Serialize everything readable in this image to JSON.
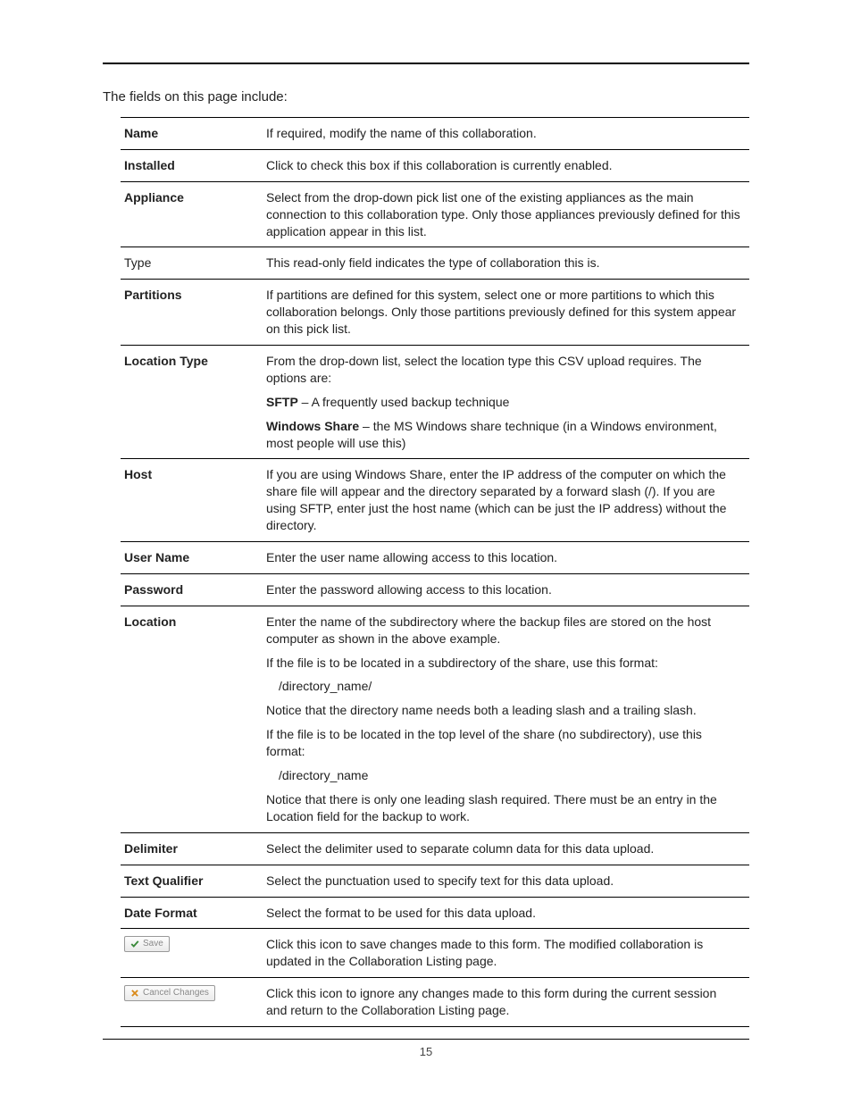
{
  "intro": "The fields on this page include:",
  "rows": {
    "name": {
      "label": "Name",
      "desc": "If required, modify the name of this collaboration."
    },
    "installed": {
      "label": "Installed",
      "desc": "Click to check this box if this collaboration is currently enabled."
    },
    "appliance": {
      "label": "Appliance",
      "desc": "Select from the drop-down pick list one of the existing appliances as the main connection to this collaboration type. Only those appliances previously defined for this application appear in this list."
    },
    "type": {
      "label": "Type",
      "desc": "This read-only field indicates the type of collaboration this is."
    },
    "partitions": {
      "label": "Partitions",
      "desc": "If partitions are defined for this system, select one or more partitions to which this collaboration belongs. Only those partitions previously defined for this system appear on this pick list."
    },
    "location_type": {
      "label": "Location Type",
      "p1": "From the drop-down list, select the location type this CSV upload requires. The options are:",
      "sftp_bold": "SFTP",
      "sftp_rest": " – A frequently used backup technique",
      "ws_bold": "Windows Share",
      "ws_rest": " – the MS Windows share technique (in a Windows environment, most people will use this)"
    },
    "host": {
      "label": "Host",
      "desc": "If you are using Windows Share, enter the IP address of the computer on which the share file will appear and the directory separated by a forward slash (/). If you are using SFTP, enter just the host name (which can be just the IP address) without the directory."
    },
    "username": {
      "label": "User Name",
      "desc": "Enter the user name allowing access to this location."
    },
    "password": {
      "label": "Password",
      "desc": "Enter the password allowing access to this location."
    },
    "location": {
      "label": "Location",
      "p1": "Enter the name of the subdirectory where the backup files are stored on the host computer as shown in the above example.",
      "p2": "If the file is to be located in a subdirectory of the share, use this format:",
      "code1": "/directory_name/",
      "p3": "Notice that the directory name needs both a leading slash and a trailing slash.",
      "p4": "If the file is to be located in the top level of the share (no subdirectory), use this format:",
      "code2": "/directory_name",
      "p5": "Notice that there is only one leading slash required. There must be an entry in the Location field for the backup to work."
    },
    "delimiter": {
      "label": "Delimiter",
      "desc": "Select the delimiter used to separate column data for this data upload."
    },
    "text_qualifier": {
      "label": "Text Qualifier",
      "desc": "Select the punctuation used to specify text for this data upload."
    },
    "date_format": {
      "label": "Date Format",
      "desc": "Select the format to be used for this data upload."
    },
    "save": {
      "btn": "Save",
      "desc": "Click this icon to save changes made to this form. The modified collaboration is updated in the Collaboration Listing page."
    },
    "cancel": {
      "btn": "Cancel Changes",
      "desc": "Click this icon to ignore any changes made to this form during the current session and return to the Collaboration Listing page."
    }
  },
  "page_number": "15"
}
